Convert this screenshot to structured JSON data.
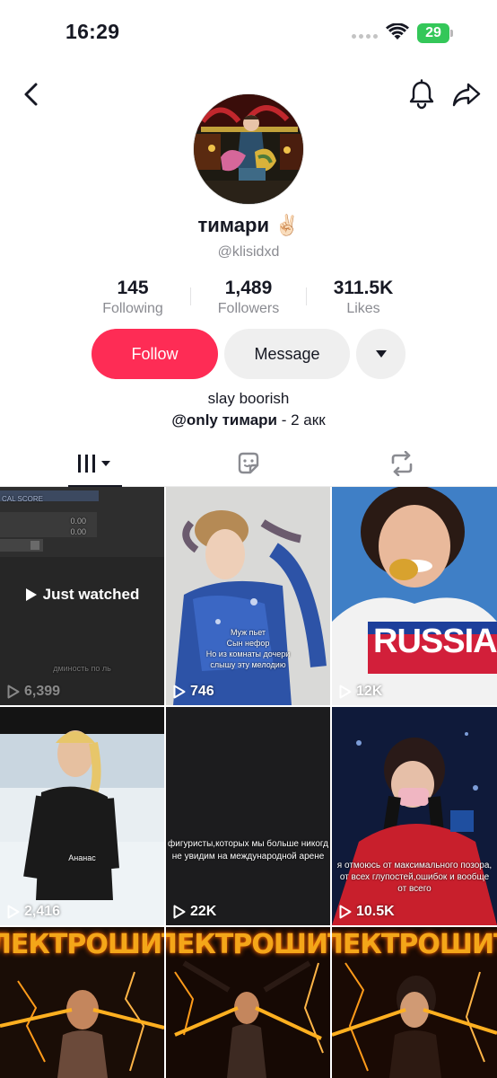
{
  "status_bar": {
    "time": "16:29",
    "battery": "29"
  },
  "profile": {
    "display_name": "тимари ✌🏻",
    "username": "@klisidxd"
  },
  "stats": [
    {
      "value": "145",
      "label": "Following"
    },
    {
      "value": "1,489",
      "label": "Followers"
    },
    {
      "value": "311.5K",
      "label": "Likes"
    }
  ],
  "actions": {
    "follow_label": "Follow",
    "message_label": "Message"
  },
  "bio": {
    "line1": "slay boorish",
    "mention": "@only тимари",
    "line2_rest": " - 2 акк"
  },
  "videos": [
    {
      "views": "6,399",
      "overlay": "Just watched",
      "caption": "дминость по ль"
    },
    {
      "views": "746",
      "caption": "Муж пьет\nСын нефор\nНо из комнаты дочери\nслышу эту мелодию"
    },
    {
      "views": "12K",
      "caption": ""
    },
    {
      "views": "2,416",
      "caption": "Ананас"
    },
    {
      "views": "22K",
      "caption": "фигуристы,которых мы больше никогд\nне увидим на международной арене"
    },
    {
      "views": "10.5K",
      "caption": "я отмоюсь от максимального позора,\nот всех глупостей,ошибок и вообще\nот всего"
    },
    {
      "views": "",
      "banner": "ЛЕКТРОШИТО"
    },
    {
      "views": "",
      "banner": "ЛЕКТРОШИТО"
    },
    {
      "views": "",
      "banner": "ЛЕКТРОШИТО"
    }
  ],
  "colors": {
    "accent": "#fe2c55",
    "text": "#161823",
    "muted": "#8a8b91",
    "battery": "#34c759"
  },
  "icons": [
    "back-arrow-icon",
    "bell-icon",
    "share-icon",
    "dropdown-icon",
    "grid-icon",
    "tagged-icon",
    "repost-icon",
    "play-icon"
  ]
}
